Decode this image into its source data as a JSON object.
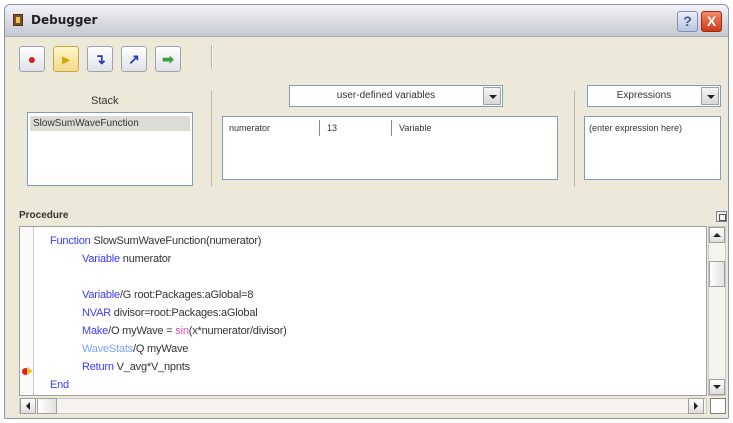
{
  "window": {
    "title": "Debugger",
    "help_glyph": "?",
    "close_glyph": "X"
  },
  "toolbar": [
    {
      "name": "stop-icon",
      "glyph": "●",
      "color": "#d02020"
    },
    {
      "name": "step-icon",
      "glyph": "▸",
      "color": "#d8a000",
      "pressed": true
    },
    {
      "name": "step-into-icon",
      "glyph": "↴",
      "color": "#2a3ab8"
    },
    {
      "name": "step-out-icon",
      "glyph": "↗",
      "color": "#2a3ab8"
    },
    {
      "name": "go-icon",
      "glyph": "➡",
      "color": "#3aa040"
    }
  ],
  "stack": {
    "label": "Stack",
    "items": [
      "SlowSumWaveFunction"
    ]
  },
  "variables": {
    "selector": "user-defined variables",
    "rows": [
      {
        "name": "numerator",
        "value": "13",
        "type": "Variable"
      }
    ]
  },
  "expressions": {
    "selector": "Expressions",
    "placeholder": "(enter expression here)"
  },
  "procedure": {
    "title": "Procedure",
    "lines": [
      [
        {
          "t": "Function",
          "c": "kw"
        },
        {
          "t": " SlowSumWaveFunction(numerator)",
          "c": "tx"
        }
      ],
      [
        {
          "t": "Variable",
          "c": "kw"
        },
        {
          "t": " numerator",
          "c": "tx"
        }
      ],
      [],
      [
        {
          "t": "Variable",
          "c": "kw"
        },
        {
          "t": "/G root:Packages:aGlobal=8",
          "c": "tx"
        }
      ],
      [
        {
          "t": "NVAR",
          "c": "kw"
        },
        {
          "t": " divisor=root:Packages:aGlobal",
          "c": "tx"
        }
      ],
      [
        {
          "t": "Make",
          "c": "kw"
        },
        {
          "t": "/O myWave = ",
          "c": "tx"
        },
        {
          "t": "sin",
          "c": "fn"
        },
        {
          "t": "(x*numerator/divisor)",
          "c": "tx"
        }
      ],
      [
        {
          "t": "WaveStats",
          "c": "wv"
        },
        {
          "t": "/Q myWave",
          "c": "tx"
        }
      ],
      [
        {
          "t": "Return",
          "c": "kw"
        },
        {
          "t": " V_avg*V_npnts",
          "c": "tx"
        }
      ],
      [
        {
          "t": "End",
          "c": "kw"
        }
      ]
    ]
  }
}
